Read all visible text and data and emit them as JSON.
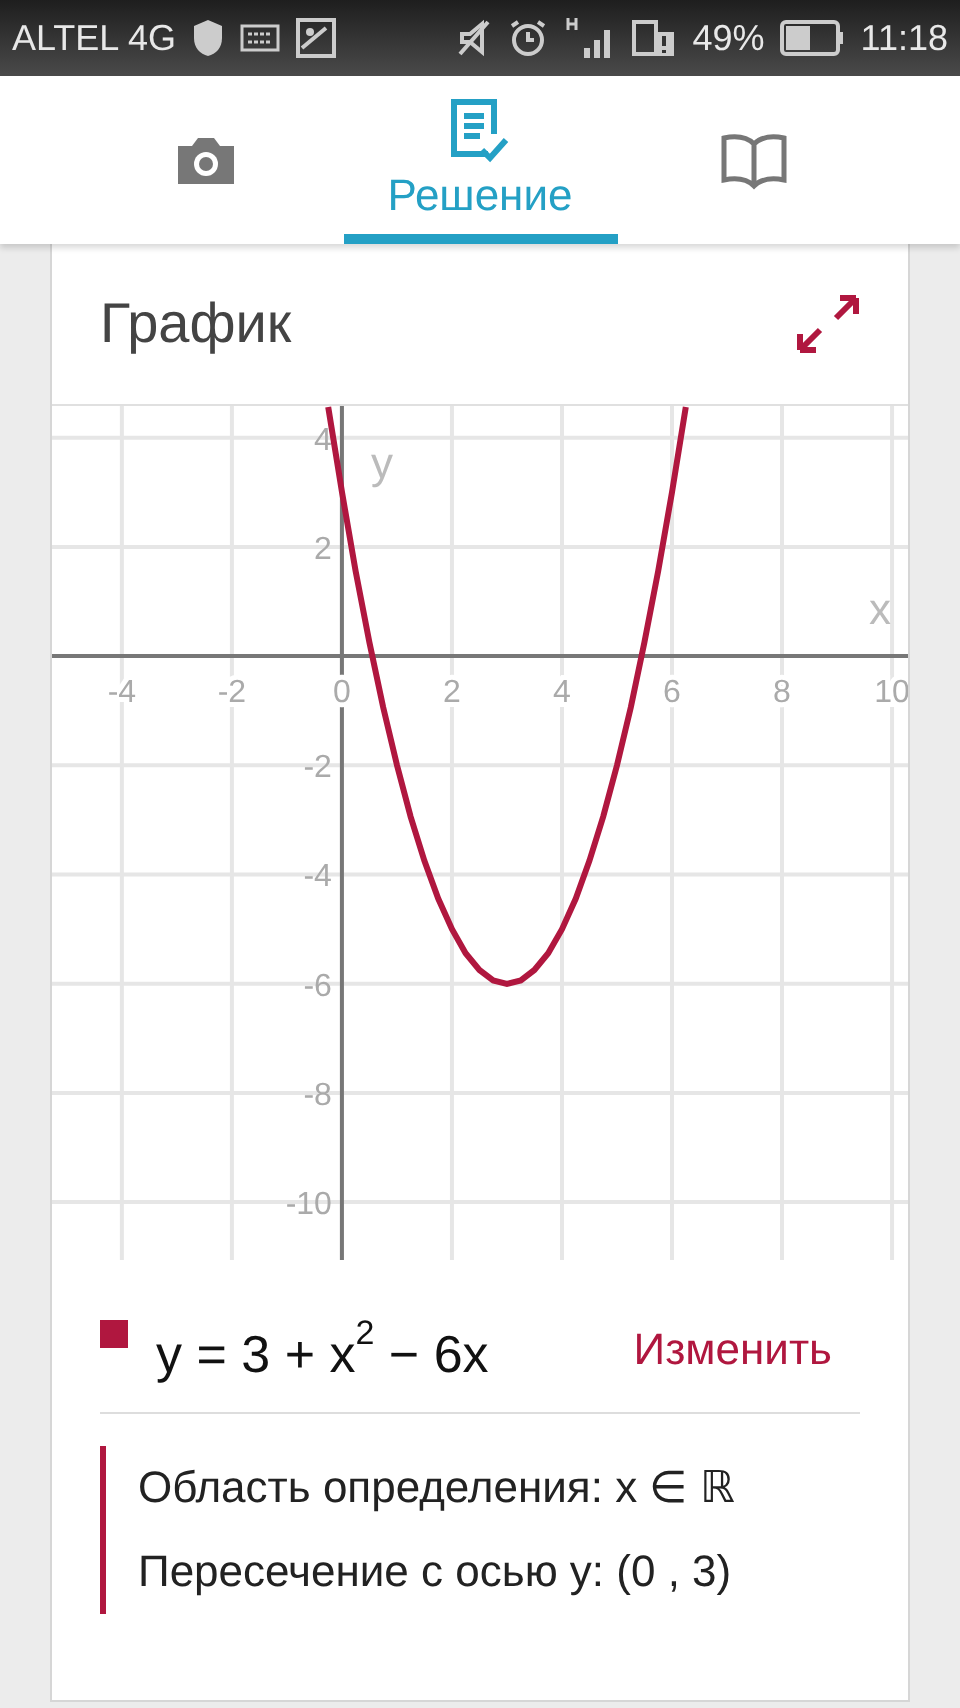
{
  "status_bar": {
    "carrier": "ALTEL 4G",
    "battery_percent": "49%",
    "time": "11:18"
  },
  "tabs": [
    {
      "kind": "camera",
      "selected": false
    },
    {
      "kind": "solution",
      "label": "Решение",
      "selected": true
    },
    {
      "kind": "book",
      "selected": false
    }
  ],
  "card": {
    "title": "График",
    "chart_data": {
      "type": "line",
      "grid": true,
      "xlabel": "x",
      "ylabel": "y",
      "xlim": [
        -5.27,
        10.29
      ],
      "ylim": [
        -11.06,
        4.58
      ],
      "xticks": [
        -4,
        -2,
        0,
        2,
        4,
        6,
        8,
        10
      ],
      "yticks": [
        4,
        2,
        -2,
        -4,
        -6,
        -8,
        -10
      ],
      "x": [
        -0.25,
        0,
        0.25,
        0.5,
        0.75,
        1,
        1.25,
        1.5,
        1.75,
        2,
        2.25,
        2.5,
        2.75,
        3,
        3.25,
        3.5,
        3.75,
        4,
        4.25,
        4.5,
        4.75,
        5,
        5.25,
        5.5,
        5.75,
        6,
        6.25
      ],
      "series": [
        {
          "color": "#b0173f",
          "values": [
            4.56,
            3,
            1.56,
            0.25,
            -0.94,
            -2,
            -2.94,
            -3.75,
            -4.44,
            -5,
            -5.44,
            -5.75,
            -5.94,
            -6,
            -5.94,
            -5.75,
            -5.44,
            -5,
            -4.44,
            -3.75,
            -2.94,
            -2,
            -0.94,
            0.25,
            1.56,
            3,
            4.56
          ]
        }
      ]
    },
    "legend": {
      "color": "#b0173f",
      "formula": "y = 3 + x$^{2}$ − 6x",
      "edit_link": "Изменить"
    },
    "properties": [
      "Область определения: x ∈ ℝ",
      "Пересечение с осью y: (0 , 3)"
    ]
  }
}
